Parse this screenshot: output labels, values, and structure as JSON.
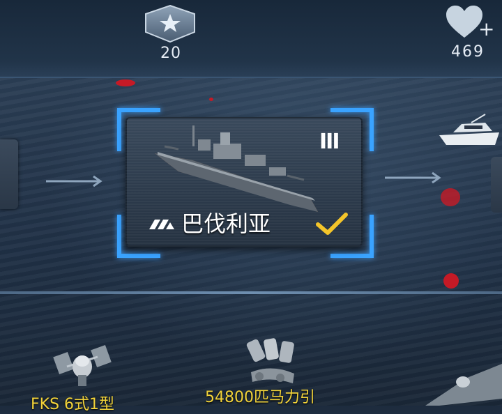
{
  "header": {
    "rank_value": "20",
    "hearts_value": "469",
    "hearts_add": "+"
  },
  "ship_card": {
    "name": "巴伐利亚",
    "tier": "III",
    "selected": true
  },
  "parts": [
    {
      "label": "FKS 6式1型"
    },
    {
      "label": "54800匹马力引"
    }
  ],
  "colors": {
    "bracket": "#3aa3ff",
    "check": "#f4c52a",
    "part_text": "#f2d33a"
  }
}
